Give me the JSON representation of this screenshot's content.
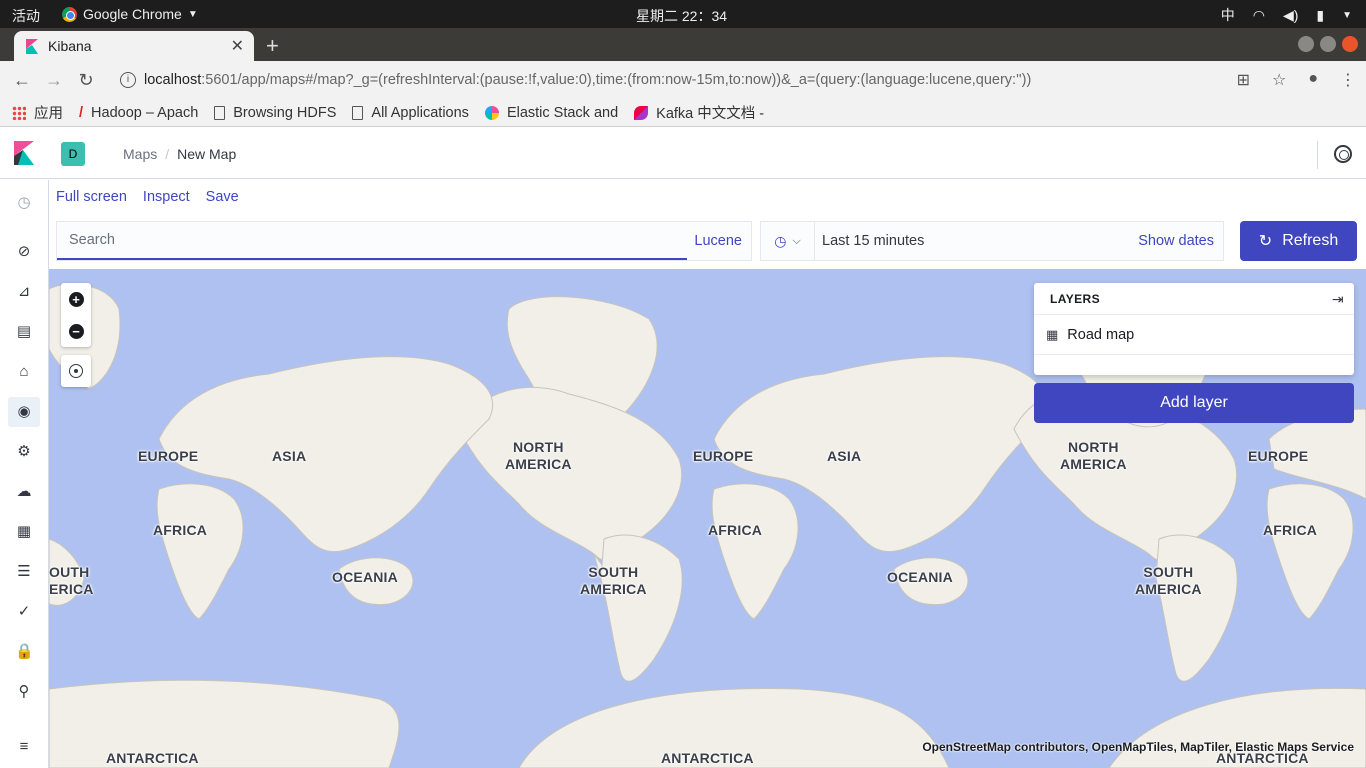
{
  "os": {
    "activities": "活动",
    "app": "Google Chrome",
    "clock": "星期二 22：34",
    "ime": "中"
  },
  "browser": {
    "tab_title": "Kibana",
    "url_host": "localhost",
    "url_path": ":5601/app/maps#/map?_g=(refreshInterval:(pause:!f,value:0),time:(from:now-15m,to:now))&_a=(query:(language:lucene,query:''))",
    "bookmarks": [
      "应用",
      "Hadoop – Apach",
      "Browsing HDFS",
      "All Applications",
      "Elastic Stack and",
      "Kafka 中文文档 -"
    ]
  },
  "kibana": {
    "space": "D",
    "breadcrumbs": [
      "Maps",
      "New Map"
    ],
    "menu": [
      "Full screen",
      "Inspect",
      "Save"
    ],
    "search_placeholder": "Search",
    "query_language": "Lucene",
    "time_range": "Last 15 minutes",
    "show_dates": "Show dates",
    "refresh": "Refresh"
  },
  "map": {
    "layers_title": "LAYERS",
    "layers": [
      "Road map"
    ],
    "add_layer": "Add layer",
    "attribution": "OpenStreetMap contributors, OpenMapTiles, MapTiler, Elastic Maps Service",
    "labels": {
      "europe": "EUROPE",
      "asia": "ASIA",
      "africa": "AFRICA",
      "oceania": "OCEANIA",
      "north_america": "NORTH\nAMERICA",
      "south_america": "SOUTH\nAMERICA",
      "south_america_cut": "OUTH\nERICA",
      "antarctica": "ANTARCTICA"
    }
  }
}
